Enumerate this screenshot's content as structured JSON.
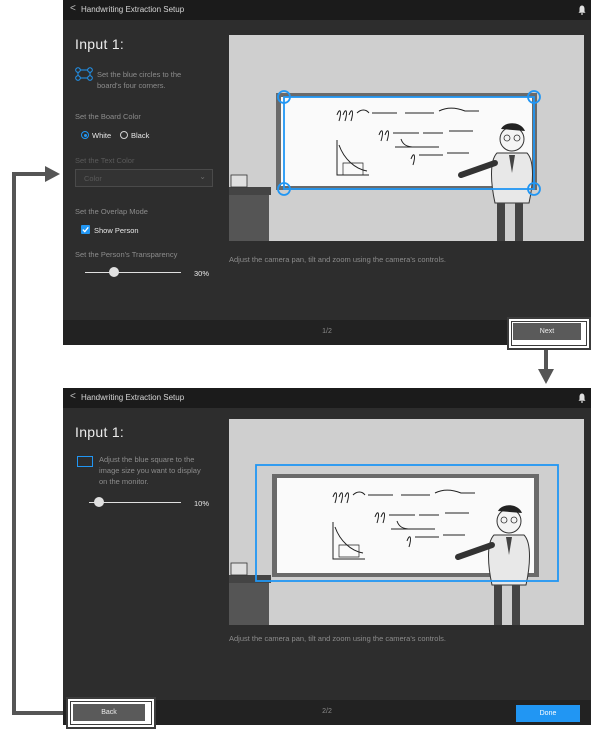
{
  "colors": {
    "accent": "#2196f3",
    "panel_bg": "#2d2d2d",
    "title_bar": "#1b1b1b",
    "footer_bg": "#222222",
    "arrow": "#555555"
  },
  "screen1": {
    "title_bar": {
      "back_glyph": "<",
      "title": "Handwriting Extraction Setup",
      "bell_icon": "bell-icon"
    },
    "input_title": "Input 1:",
    "instruction_line1": "Set the blue circles to the",
    "instruction_line2": "board's four corners.",
    "board_color_label": "Set the Board Color",
    "white_option": "White",
    "black_option": "Black",
    "board_color_selected": "White",
    "text_color_label": "Set the Text Color",
    "color_dropdown_value": "Color",
    "overlap_label": "Set the Overlap Mode",
    "show_person_label": "Show Person",
    "show_person_checked": true,
    "transparency_label": "Set the Person's Transparency",
    "transparency_value": "30%",
    "transparency_fraction": 0.3,
    "camera_hint": "Adjust the camera pan, tilt and zoom using the camera's controls.",
    "page_indicator": "1/2",
    "next_button": "Next"
  },
  "screen2": {
    "title_bar": {
      "back_glyph": "<",
      "title": "Handwriting Extraction Setup",
      "bell_icon": "bell-icon"
    },
    "input_title": "Input 1:",
    "instruction_line1": "Adjust the blue square to the",
    "instruction_line2": "image size you want to display",
    "instruction_line3": "on the monitor.",
    "size_value": "10%",
    "size_fraction": 0.1,
    "camera_hint": "Adjust the camera pan, tilt and zoom using the camera's controls.",
    "page_indicator": "2/2",
    "back_button": "Back",
    "done_button": "Done"
  }
}
